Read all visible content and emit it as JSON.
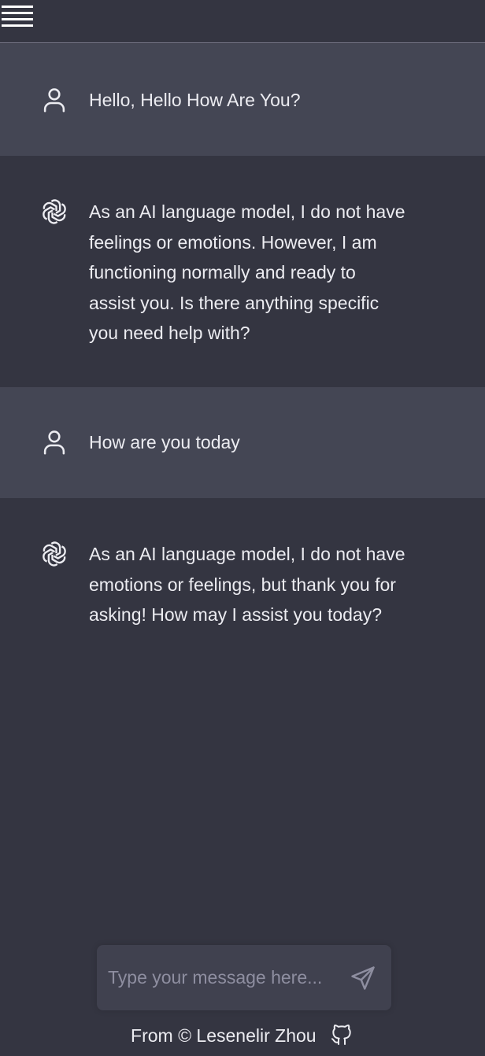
{
  "menu": {
    "icon": "hamburger-menu-icon"
  },
  "conversation": [
    {
      "role": "user",
      "avatar_icon": "user-icon",
      "text": "Hello, Hello How Are You?"
    },
    {
      "role": "assistant",
      "avatar_icon": "openai-logo-icon",
      "text": "As an AI language model, I do not have\nfeelings or emotions. However, I am\nfunctioning normally and ready to\nassist you. Is there anything specific\nyou need help with?"
    },
    {
      "role": "user",
      "avatar_icon": "user-icon",
      "text": "How are you today"
    },
    {
      "role": "assistant",
      "avatar_icon": "openai-logo-icon",
      "text": "As an AI language model, I do not have\nemotions or feelings, but thank you for\nasking! How may I assist you today?"
    }
  ],
  "composer": {
    "placeholder": "Type your message here...",
    "value": "",
    "send_icon": "send-icon"
  },
  "footer": {
    "text": "From © Lesenelir Zhou",
    "github_icon": "github-icon"
  },
  "colors": {
    "background": "#343541",
    "user_row": "#444654",
    "input_bg": "#40414f",
    "text": "#ececf1",
    "muted": "#8e8ea0"
  }
}
